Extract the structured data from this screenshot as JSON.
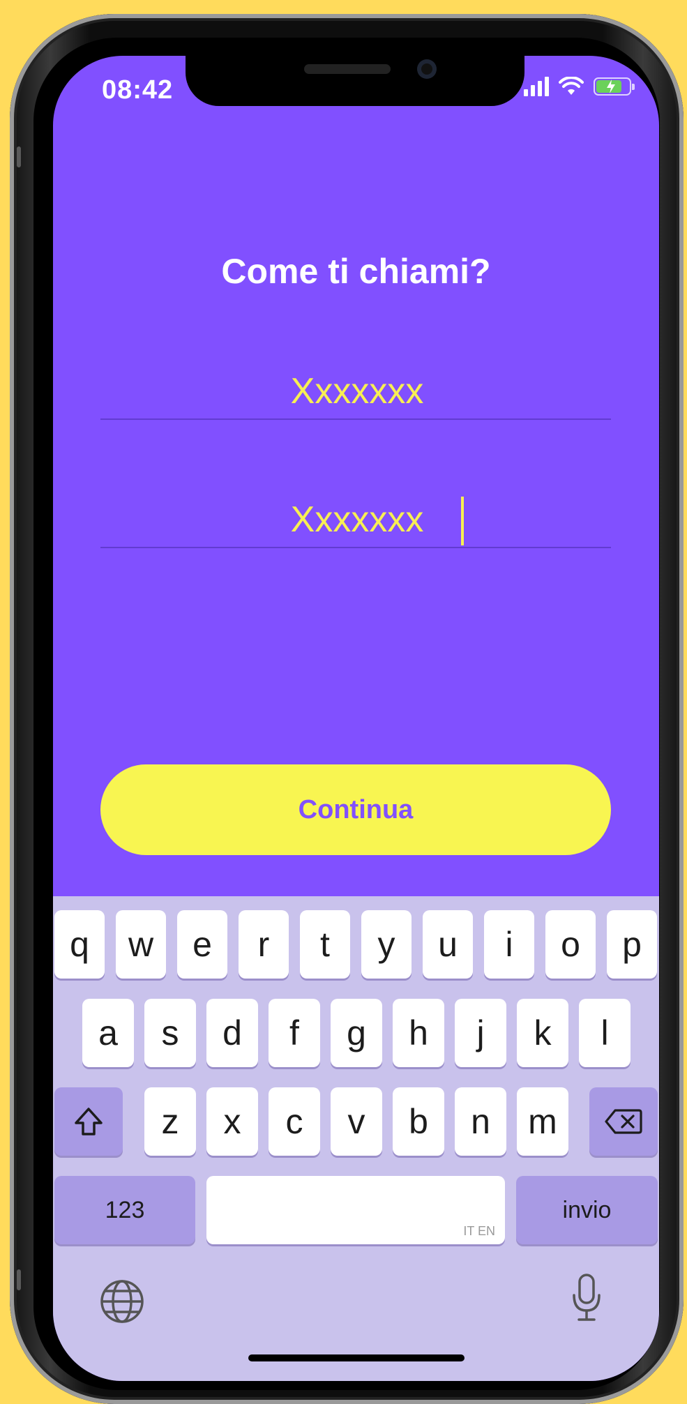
{
  "status_bar": {
    "time": "08:42"
  },
  "title": "Come ti chiami?",
  "fields": [
    {
      "value": "Xxxxxxx"
    },
    {
      "value": "Xxxxxxx"
    }
  ],
  "continue_label": "Continua",
  "keyboard": {
    "row1": [
      "q",
      "w",
      "e",
      "r",
      "t",
      "y",
      "u",
      "i",
      "o",
      "p"
    ],
    "row2": [
      "a",
      "s",
      "d",
      "f",
      "g",
      "h",
      "j",
      "k",
      "l"
    ],
    "row3": [
      "z",
      "x",
      "c",
      "v",
      "b",
      "n",
      "m"
    ],
    "numbers_label": "123",
    "return_label": "invio",
    "space_lang": "IT EN"
  },
  "colors": {
    "background": "#FFDB5C",
    "screen": "#8150FF",
    "accent": "#F8F551",
    "keyboard": "#C9C2EC"
  },
  "icons": [
    "shift-icon",
    "backspace-icon",
    "globe-icon",
    "microphone-icon",
    "signal-icon",
    "wifi-icon",
    "battery-icon"
  ]
}
